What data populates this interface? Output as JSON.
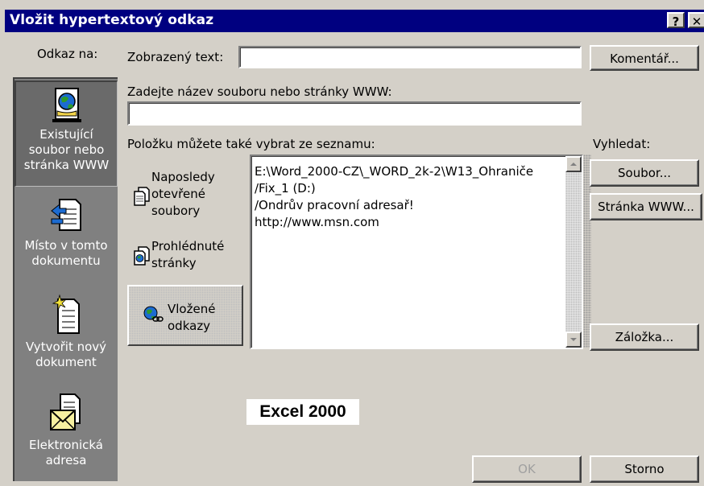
{
  "window": {
    "title": "Vložit hypertextový odkaz",
    "help_glyph": "?",
    "close_glyph": "✕"
  },
  "link_to": {
    "label": "Odkaz na:",
    "items": [
      {
        "label_lines": [
          "Existující",
          "soubor nebo",
          "stránka WWW"
        ],
        "icon": "web-page-icon",
        "selected": true
      },
      {
        "label_lines": [
          "Místo v tomto",
          "dokumentu"
        ],
        "icon": "document-place-icon",
        "selected": false
      },
      {
        "label_lines": [
          "Vytvořit nový",
          "dokument"
        ],
        "icon": "new-document-icon",
        "selected": false
      },
      {
        "label_lines": [
          "Elektronická",
          "adresa"
        ],
        "icon": "email-icon",
        "selected": false
      }
    ]
  },
  "display_text": {
    "label": "Zobrazený text:",
    "value": ""
  },
  "screentip_button": "Komentář...",
  "url_field": {
    "label": "Zadejte název souboru nebo stránky WWW:",
    "value": ""
  },
  "list_label": "Položku můžete také vybrat ze seznamu:",
  "browse_label": "Vyhledat:",
  "sub_nav": [
    {
      "label_lines": [
        "Naposledy",
        "otevřené",
        "soubory"
      ],
      "icon": "recent-files-icon",
      "selected": false
    },
    {
      "label_lines": [
        "Prohlédnuté",
        "stránky"
      ],
      "icon": "browsed-pages-icon",
      "selected": false
    },
    {
      "label_lines": [
        "Vložené",
        "odkazy"
      ],
      "icon": "inserted-links-icon",
      "selected": true
    }
  ],
  "links_list": [
    "E:\\Word_2000-CZ\\_WORD_2k-2\\W13_Ohraniče",
    "/Fix_1 (D:)",
    "/Ondrův pracovní adresař!",
    "http://www.msn.com"
  ],
  "buttons": {
    "file": "Soubor...",
    "web_page": "Stránka WWW...",
    "bookmark": "Záložka...",
    "ok": "OK",
    "cancel": "Storno"
  },
  "stamp": "Excel 2000",
  "colors": {
    "titlebar": "#000080",
    "dialog": "#d4d0c8",
    "sidebar": "#808080"
  }
}
